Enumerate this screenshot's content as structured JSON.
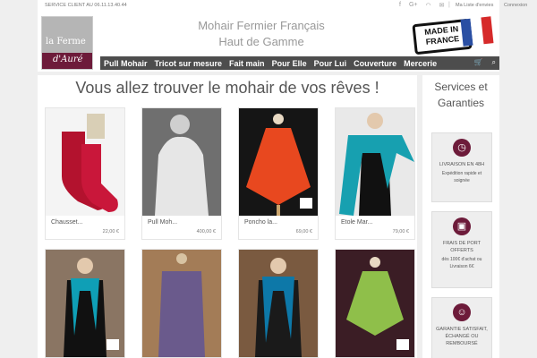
{
  "topbar": {
    "phone": "SERVICE CLIENT AU 06.11.13.40.44",
    "social_icons": [
      "facebook-icon",
      "google-plus-icon",
      "rss-icon",
      "email-icon"
    ],
    "wishlist": "Ma Liste d'envies",
    "login": "Connexion"
  },
  "header": {
    "logo_top": "la Ferme",
    "logo_bottom": "d'Auré",
    "tagline_1": "Mohair Fermier Français",
    "tagline_2": "Haut de Gamme",
    "badge_1": "MADE IN",
    "badge_2": "FRANCE"
  },
  "nav": {
    "items": [
      "Pull Mohair",
      "Tricot sur mesure",
      "Fait main",
      "Pour Elle",
      "Pour Lui",
      "Couverture",
      "Mercerie"
    ],
    "cart_glyph": "🛒",
    "search_glyph": "⌕"
  },
  "main": {
    "headline": "Vous allez trouver le mohair de vos rêves !",
    "products": [
      {
        "name": "Chausset...",
        "price": "22,00 €"
      },
      {
        "name": "Pull Moh...",
        "price": "400,00 €"
      },
      {
        "name": "Poncho la...",
        "price": "69,00 €"
      },
      {
        "name": "Etole Mar...",
        "price": "79,00 €"
      }
    ]
  },
  "sidebar": {
    "title_1": "Services et",
    "title_2": "Garanties",
    "services": [
      {
        "icon": "clock-icon",
        "glyph": "◷",
        "title": "LIVRAISON EN 48H",
        "sub": "Expédition rapide et soignée"
      },
      {
        "icon": "gift-icon",
        "glyph": "▣",
        "title": "FRAIS DE PORT OFFERTS",
        "sub": "dès 100€ d'achat ou Livraison 6€"
      },
      {
        "icon": "smile-icon",
        "glyph": "☺",
        "title": "GARANTIE SATISFAIT, ÉCHANGÉ OU REMBOURSÉ",
        "sub": ""
      }
    ]
  },
  "colors": {
    "brand": "#6d1b3a",
    "nav_bg": "#4d4d4d",
    "page_bg": "#efefef"
  }
}
